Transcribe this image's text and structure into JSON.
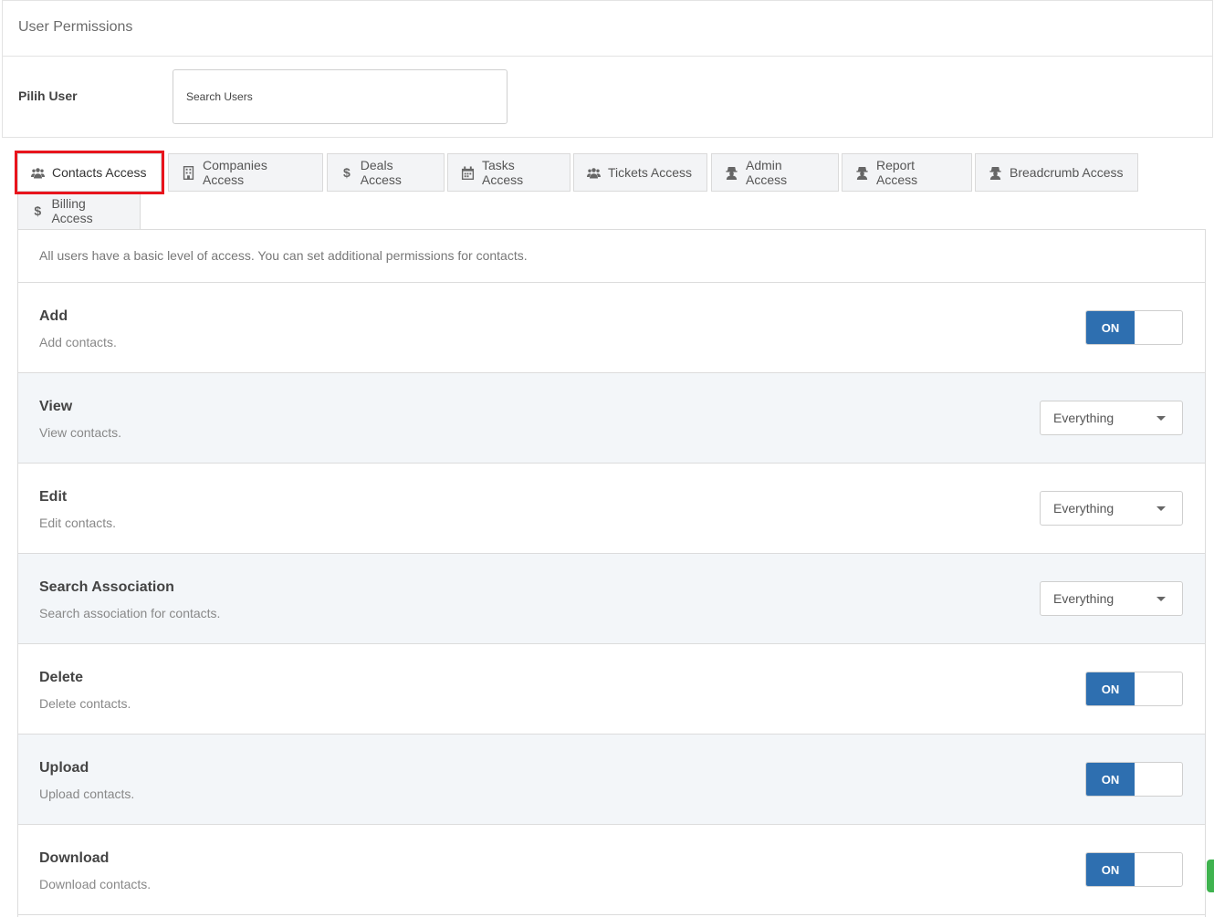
{
  "header": {
    "title": "User Permissions"
  },
  "user_select": {
    "label": "Pilih User",
    "placeholder": "Search Users"
  },
  "tabs": [
    {
      "label": "Contacts Access",
      "icon": "users-icon",
      "active": true
    },
    {
      "label": "Companies Access",
      "icon": "building-icon",
      "active": false
    },
    {
      "label": "Deals Access",
      "icon": "dollar-icon",
      "active": false
    },
    {
      "label": "Tasks Access",
      "icon": "calendar-icon",
      "active": false
    },
    {
      "label": "Tickets Access",
      "icon": "users-icon",
      "active": false
    },
    {
      "label": "Admin Access",
      "icon": "user-secret-icon",
      "active": false
    },
    {
      "label": "Report Access",
      "icon": "user-secret-icon",
      "active": false
    },
    {
      "label": "Breadcrumb Access",
      "icon": "user-secret-icon",
      "active": false
    },
    {
      "label": "Billing Access",
      "icon": "dollar-icon",
      "active": false
    }
  ],
  "intro": "All users have a basic level of access. You can set additional permissions for contacts.",
  "permissions": [
    {
      "title": "Add",
      "desc": "Add contacts.",
      "control": "toggle",
      "value": "ON"
    },
    {
      "title": "View",
      "desc": "View contacts.",
      "control": "select",
      "value": "Everything"
    },
    {
      "title": "Edit",
      "desc": "Edit contacts.",
      "control": "select",
      "value": "Everything"
    },
    {
      "title": "Search Association",
      "desc": "Search association for contacts.",
      "control": "select",
      "value": "Everything"
    },
    {
      "title": "Delete",
      "desc": "Delete contacts.",
      "control": "toggle",
      "value": "ON"
    },
    {
      "title": "Upload",
      "desc": "Upload contacts.",
      "control": "toggle",
      "value": "ON"
    },
    {
      "title": "Download",
      "desc": "Download contacts.",
      "control": "toggle",
      "value": "ON"
    }
  ],
  "colors": {
    "toggle_on": "#2e6fb0",
    "highlight": "#e8141c",
    "alt_row": "#f3f6f9"
  }
}
